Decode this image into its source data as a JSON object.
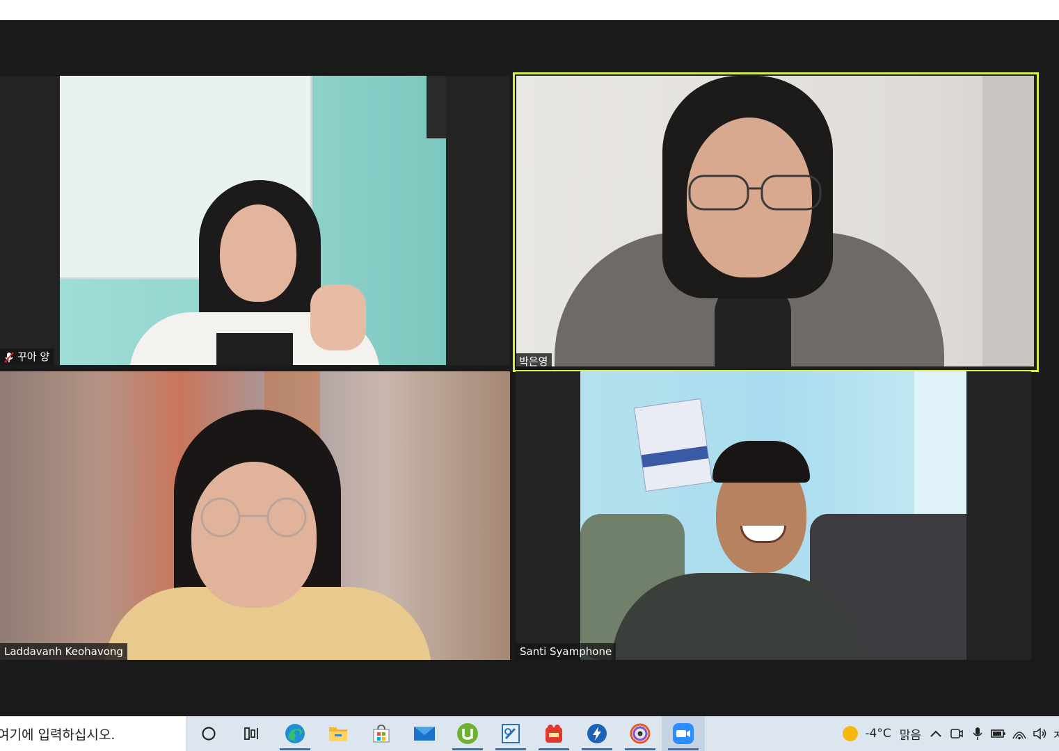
{
  "meeting": {
    "participants": [
      {
        "id": "t1",
        "name": "꾸아 양",
        "muted": true,
        "active_speaker": false
      },
      {
        "id": "t2",
        "name": "박은영",
        "muted": false,
        "active_speaker": true
      },
      {
        "id": "t3",
        "name": "Laddavanh Keohavong",
        "muted": false,
        "active_speaker": false
      },
      {
        "id": "t4",
        "name": "Santi Syamphone",
        "muted": false,
        "active_speaker": false
      }
    ],
    "active_speaker_color": "#d8ec47"
  },
  "taskbar": {
    "search_placeholder": "여기에 입력하십시오.",
    "apps": [
      "cortana-icon",
      "task-view-icon",
      "edge-icon",
      "file-explorer-icon",
      "microsoft-store-icon",
      "mail-icon",
      "utorrent-icon",
      "editor-icon",
      "pdf-app-icon",
      "app-bolt-icon",
      "media-player-icon",
      "zoom-icon"
    ],
    "weather": {
      "temperature": "-4°C",
      "condition": "맑음"
    },
    "tray_overflow": "ㅈ"
  }
}
